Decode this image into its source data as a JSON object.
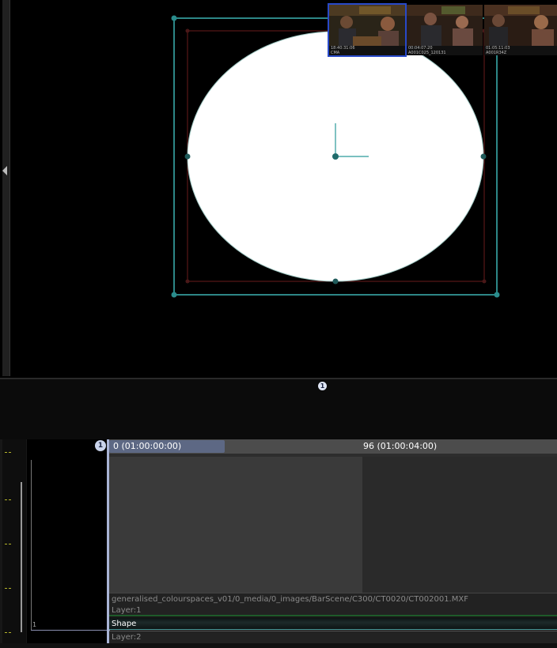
{
  "viewer": {
    "shape": {
      "fill": "#ffffff",
      "handle_color": "#2a8c8c",
      "bbox_color": "#3cb4b4",
      "inner_color": "#6a1c1c"
    }
  },
  "thumbnails": {
    "badge": "1",
    "items": [
      {
        "line1": "18:40:31:06",
        "line2": "CMA"
      },
      {
        "line1": "00:04:07:20",
        "line2": "A001C025_120131"
      },
      {
        "line1": "01:05:11:03",
        "line2": "A001R34Z"
      }
    ]
  },
  "timeline": {
    "playhead_badge": "1",
    "in_marker": "0 (01:00:00:00)",
    "out_marker": "96 (01:00:04:00)",
    "track_number": "1",
    "rows": {
      "path": "generalised_colourspaces_v01/0_media/0_images/BarScene/C300/CT0020/CT002001.MXF",
      "layer1": "Layer:1",
      "shape": "Shape",
      "layer2": "Layer:2"
    }
  },
  "colors": {
    "accent": "#5d6884",
    "selection": "#2849c8"
  }
}
